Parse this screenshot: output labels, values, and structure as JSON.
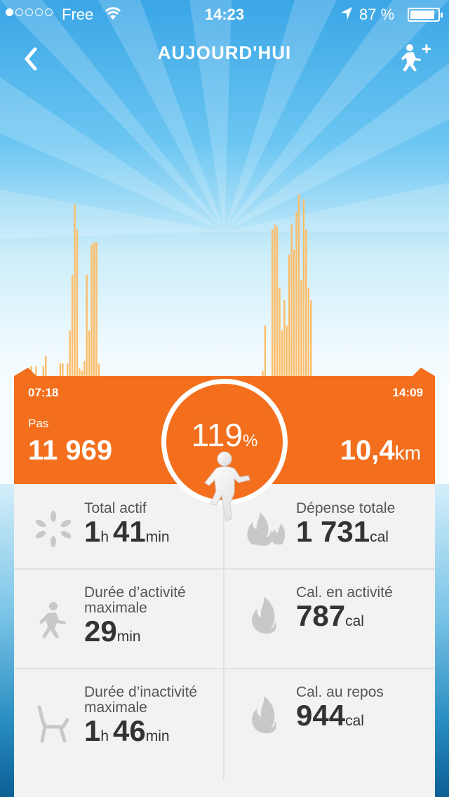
{
  "status_bar": {
    "carrier": "Free",
    "time": "14:23",
    "battery": "87 %",
    "signal_bars_filled": 1,
    "signal_bars_total": 5
  },
  "nav": {
    "title": "AUJOURD'HUI",
    "back_icon": "chevron-left-icon",
    "add_icon": "runner-plus-icon"
  },
  "chart_data": {
    "type": "bar",
    "title": "",
    "xlabel": "",
    "ylabel": "",
    "x_start": "07:18",
    "x_end": "14:09",
    "color": "#fcbd6a",
    "values": [
      0,
      4,
      0,
      4,
      0,
      0,
      4,
      8,
      0,
      0,
      0,
      0,
      0,
      5,
      5,
      0,
      5,
      18,
      40,
      68,
      58,
      3,
      2,
      6,
      40,
      18,
      52,
      53,
      53,
      5,
      0,
      0,
      0,
      0,
      0,
      0,
      0,
      0,
      0,
      0,
      0,
      0,
      0,
      0,
      0,
      0,
      0,
      0,
      0,
      0,
      0,
      0,
      0,
      0,
      0,
      0,
      0,
      0,
      0,
      0,
      0,
      0,
      0,
      0,
      0,
      0,
      0,
      0,
      0,
      0,
      0,
      0,
      0,
      0,
      0,
      0,
      0,
      0,
      0,
      0,
      0,
      0,
      0,
      0,
      0,
      0,
      0,
      0,
      0,
      0,
      0,
      0,
      0,
      0,
      0,
      0,
      0,
      2,
      20,
      0,
      0,
      58,
      60,
      59,
      35,
      18,
      30,
      20,
      48,
      60,
      50,
      65,
      72,
      38,
      70,
      58,
      35,
      30,
      0,
      0,
      0,
      0,
      0,
      0,
      0,
      0,
      0,
      0,
      0,
      0,
      0,
      0,
      0,
      0,
      0,
      0,
      0,
      0,
      0,
      0,
      0,
      0,
      0,
      0,
      0,
      0,
      0,
      0,
      0,
      0,
      0,
      0,
      0,
      0,
      0,
      0,
      0,
      0,
      0,
      0,
      0,
      0,
      0
    ]
  },
  "banner": {
    "start_time": "07:18",
    "end_time": "14:09",
    "steps_label": "Pas",
    "steps_value": "11 969",
    "goal_percent": "119",
    "goal_percent_symbol": "%",
    "distance_value": "10,4",
    "distance_unit": "km"
  },
  "stats": [
    {
      "label": "Total actif",
      "parts": [
        [
          "1",
          "h"
        ],
        [
          "41",
          "min"
        ]
      ],
      "icon": "sparkle-icon"
    },
    {
      "label": "Dépense totale",
      "parts": [
        [
          "1 731",
          "cal"
        ]
      ],
      "icon": "flames-icon"
    },
    {
      "label": "Durée d’activité maximale",
      "parts": [
        [
          "29",
          "min"
        ]
      ],
      "icon": "runner-icon"
    },
    {
      "label": "Cal. en activité",
      "parts": [
        [
          "787",
          "cal"
        ]
      ],
      "icon": "flame-icon"
    },
    {
      "label": "Durée d’inactivité maximale",
      "parts": [
        [
          "1",
          "h"
        ],
        [
          "46",
          "min"
        ]
      ],
      "icon": "chair-icon"
    },
    {
      "label": "Cal. au repos",
      "parts": [
        [
          "944",
          "cal"
        ]
      ],
      "icon": "flame-icon"
    }
  ],
  "colors": {
    "accent": "#f36f1d",
    "bars": "#fcbd6a",
    "card": "#f2f2f2",
    "icon_gray": "#c8c8c8"
  }
}
